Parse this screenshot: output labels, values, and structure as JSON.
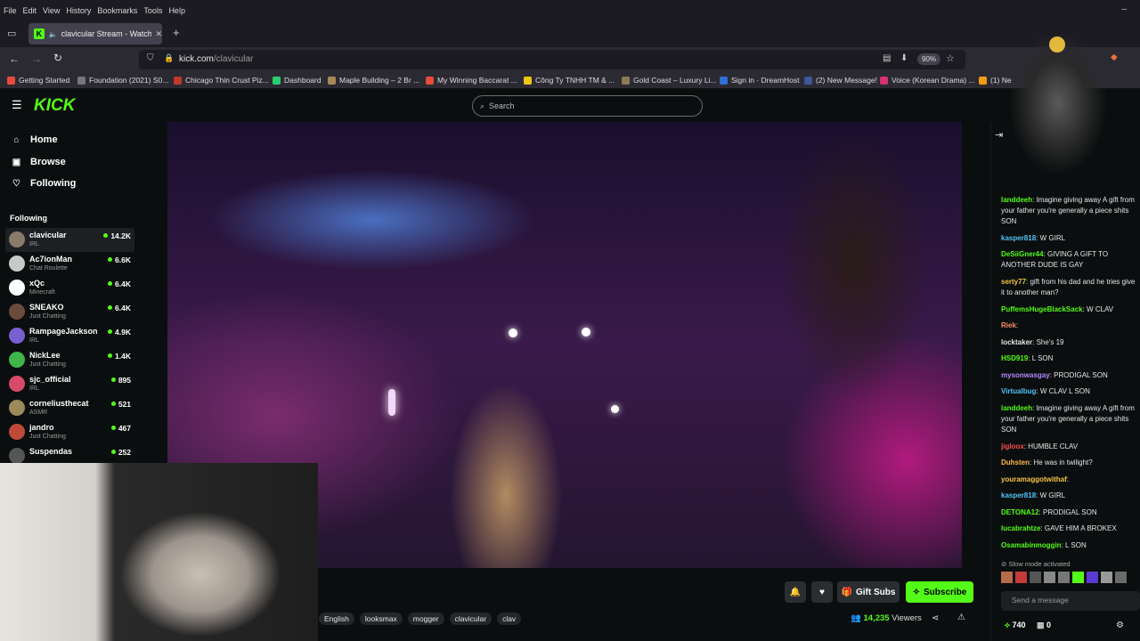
{
  "browser": {
    "menu": [
      "File",
      "Edit",
      "View",
      "History",
      "Bookmarks",
      "Tools",
      "Help"
    ],
    "tab_title": "clavicular Stream - Watch L",
    "url_host": "kick.com",
    "url_path": "/clavicular",
    "zoom": "90%",
    "bookmarks": [
      {
        "label": "Getting Started",
        "color": "#e84c3d"
      },
      {
        "label": "Foundation (2021) S0...",
        "color": "#777777"
      },
      {
        "label": "Chicago Thin Crust Piz...",
        "color": "#c0392b"
      },
      {
        "label": "Dashboard",
        "color": "#2ecc71"
      },
      {
        "label": "Maple Building – 2 Br ...",
        "color": "#aa8855"
      },
      {
        "label": "My Winning Baccarat ...",
        "color": "#e74c3c"
      },
      {
        "label": "Công Ty TNHH TM & ...",
        "color": "#f1c40f"
      },
      {
        "label": "Gold Coast – Luxury Li...",
        "color": "#8e7b52"
      },
      {
        "label": "Sign in · DreamHost",
        "color": "#2f6fd6"
      },
      {
        "label": "(2) New Message!",
        "color": "#3b5998"
      },
      {
        "label": "Voice (Korean Drama) ...",
        "color": "#d6336c"
      },
      {
        "label": "(1) Ne",
        "color": "#f39c12"
      }
    ]
  },
  "site": {
    "logo": "KICK",
    "search_placeholder": "Search",
    "nav": [
      {
        "label": "Home",
        "icon": "home-icon"
      },
      {
        "label": "Browse",
        "icon": "browse-icon"
      },
      {
        "label": "Following",
        "icon": "heart-icon"
      }
    ],
    "following_title": "Following",
    "following": [
      {
        "name": "clavicular",
        "category": "IRL",
        "viewers": "14.2K",
        "avatar": "#8a7a6a"
      },
      {
        "name": "Ac7ionMan",
        "category": "Chat Roulette",
        "viewers": "6.6K",
        "avatar": "#c9c9c9"
      },
      {
        "name": "xQc",
        "category": "Minecraft",
        "viewers": "6.4K",
        "avatar": "#ffffff"
      },
      {
        "name": "SNEAKO",
        "category": "Just Chatting",
        "viewers": "6.4K",
        "avatar": "#6b4b3b"
      },
      {
        "name": "RampageJackson",
        "category": "IRL",
        "viewers": "4.9K",
        "avatar": "#7a5fd0"
      },
      {
        "name": "NickLee",
        "category": "Just Chatting",
        "viewers": "1.4K",
        "avatar": "#3fb54a"
      },
      {
        "name": "sjc_official",
        "category": "IRL",
        "viewers": "895",
        "avatar": "#d94a6a"
      },
      {
        "name": "corneliusthecat",
        "category": "ASMR",
        "viewers": "521",
        "avatar": "#9b8a5a"
      },
      {
        "name": "jandro",
        "category": "Just Chatting",
        "viewers": "467",
        "avatar": "#c04a3a"
      },
      {
        "name": "Suspendas",
        "category": "",
        "viewers": "252",
        "avatar": "#555555"
      }
    ]
  },
  "stream": {
    "tags": [
      "English",
      "looksmax",
      "mogger",
      "clavicular",
      "clav"
    ],
    "gift_subs": "Gift Subs",
    "subscribe": "Subscribe",
    "viewers_count": "14,235",
    "viewers_label": "Viewers"
  },
  "chat": {
    "messages": [
      {
        "user": "landdeeh",
        "color": "#53fc18",
        "text": "Imagine giving away A gift from your father you're generally a piece shits SON"
      },
      {
        "user": "kasper818",
        "color": "#4fc3f7",
        "text": "W GIRL"
      },
      {
        "user": "DeSiiGner44",
        "color": "#53fc18",
        "text": "GIVING A GIFT TO ANOTHER DUDE IS GAY"
      },
      {
        "user": "serty77",
        "color": "#f5c542",
        "text": "gift from his dad and he tries give it to another man?"
      },
      {
        "user": "PuffemsHugeBlackSack",
        "color": "#53fc18",
        "text": "W CLAV"
      },
      {
        "user": "Riek",
        "color": "#ff8a65",
        "text": ""
      },
      {
        "user": "locktaker",
        "color": "#e6e6e6",
        "text": "She's 19"
      },
      {
        "user": "HSD919",
        "color": "#53fc18",
        "text": "L SON"
      },
      {
        "user": "mysonwasgay",
        "color": "#b388ff",
        "text": "PRODIGAL SON"
      },
      {
        "user": "Virtualbug",
        "color": "#4fc3f7",
        "text": "W CLAV L SON"
      },
      {
        "user": "landdeeh",
        "color": "#53fc18",
        "text": "Imagine giving away A gift from your father you're generally a piece shits SON"
      },
      {
        "user": "jigloox",
        "color": "#ff4d4d",
        "text": "HUMBLE CLAV"
      },
      {
        "user": "Duhsten",
        "color": "#ffb74d",
        "text": "He was in twilight?"
      },
      {
        "user": "youramaggotwithaf",
        "color": "#f5c542",
        "text": ""
      },
      {
        "user": "kasper818",
        "color": "#4fc3f7",
        "text": "W GIRL"
      },
      {
        "user": "DETONA12",
        "color": "#53fc18",
        "text": "PRODIGAL SON"
      },
      {
        "user": "lucabrahtze",
        "color": "#53fc18",
        "text": "GAVE HIM A BROKEX"
      },
      {
        "user": "Osamabinmoggin",
        "color": "#53fc18",
        "text": "L SON"
      }
    ],
    "slow_mode": "Slow mode activated",
    "send_placeholder": "Send a message",
    "points": "740",
    "points_other": "0"
  }
}
